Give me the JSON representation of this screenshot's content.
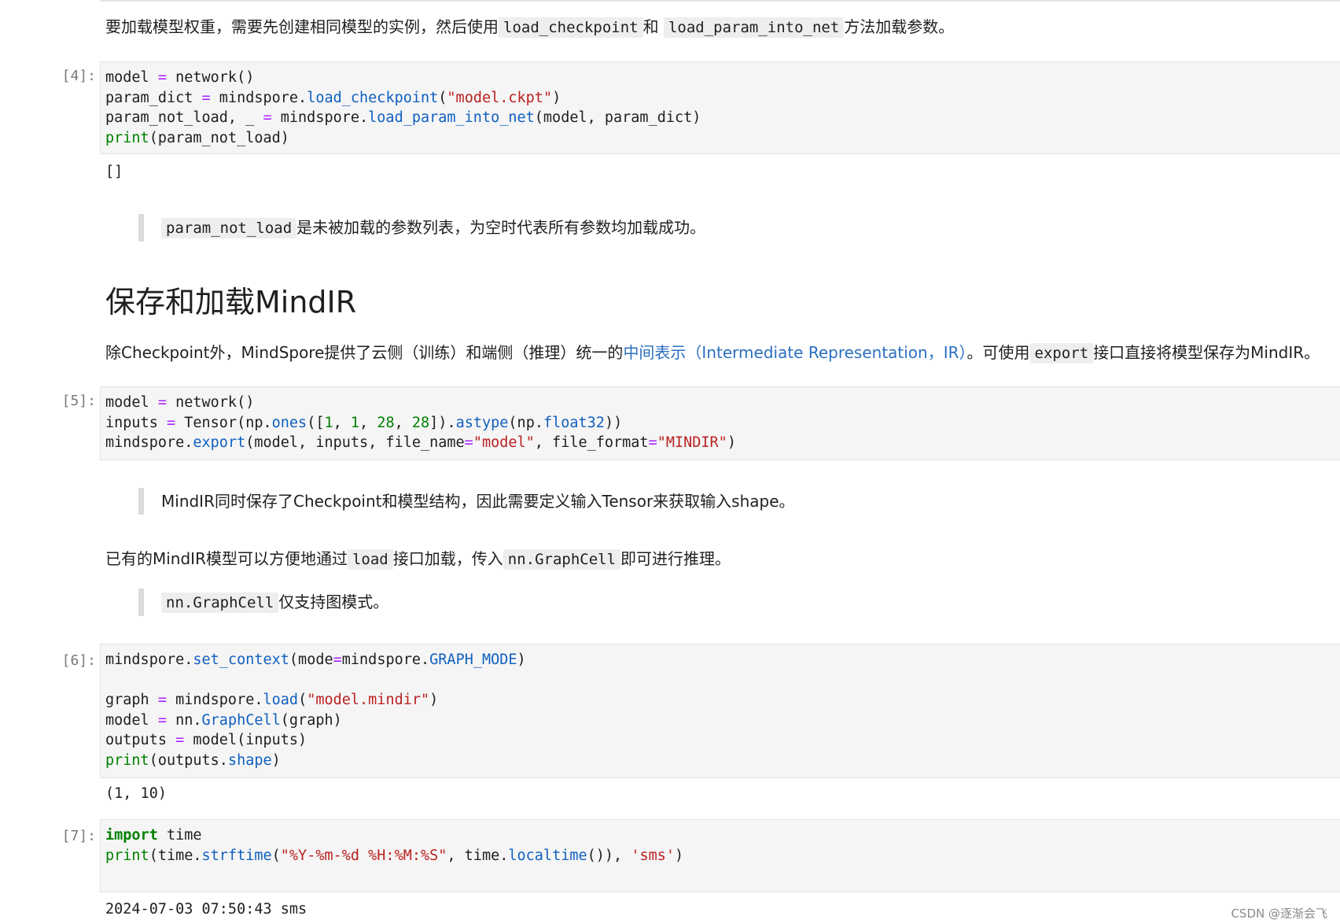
{
  "intro": {
    "p1_pre": "要加载模型权重，需要先创建相同模型的实例，然后使用",
    "p1_code1": "load_checkpoint",
    "p1_mid": "和",
    "p1_code2": "load_param_into_net",
    "p1_post": "方法加载参数。"
  },
  "cell4": {
    "prompt": "[4]:",
    "l1": {
      "a": "model ",
      "op": "=",
      "b": " network()"
    },
    "l2": {
      "a": "param_dict ",
      "op": "=",
      "b": " mindspore.",
      "fn": "load_checkpoint",
      "c": "(",
      "s": "\"model.ckpt\"",
      "d": ")"
    },
    "l3": {
      "a": "param_not_load, _ ",
      "op": "=",
      "b": " mindspore.",
      "fn": "load_param_into_net",
      "c": "(model, param_dict)"
    },
    "l4": {
      "fn": "print",
      "c": "(param_not_load)"
    },
    "output": "[]"
  },
  "note1": {
    "code": "param_not_load",
    "text": "是未被加载的参数列表，为空时代表所有参数均加载成功。"
  },
  "section": {
    "title": "保存和加载MindIR"
  },
  "p2": {
    "pre": "除Checkpoint外，MindSpore提供了云侧（训练）和端侧（推理）统一的",
    "link": "中间表示（Intermediate Representation，IR）",
    "mid": "。可使用",
    "code": "export",
    "post": "接口直接将模型保存为MindIR。"
  },
  "cell5": {
    "prompt": "[5]:",
    "l1": {
      "a": "model ",
      "op": "=",
      "b": " network()"
    },
    "l2": {
      "a": "inputs ",
      "op": "=",
      "b": " Tensor(np.",
      "fn1": "ones",
      "c": "([",
      "n1": "1",
      "s1": ", ",
      "n2": "1",
      "s2": ", ",
      "n3": "28",
      "s3": ", ",
      "n4": "28",
      "d": "]).",
      "fn2": "astype",
      "e": "(np.",
      "fn3": "float32",
      "f": "))"
    },
    "l3": {
      "a": "mindspore.",
      "fn": "export",
      "b": "(model, inputs, file_name",
      "op1": "=",
      "s1": "\"model\"",
      "c": ", file_format",
      "op2": "=",
      "s2": "\"MINDIR\"",
      "d": ")"
    }
  },
  "note2": {
    "text": "MindIR同时保存了Checkpoint和模型结构，因此需要定义输入Tensor来获取输入shape。"
  },
  "p3": {
    "pre": "已有的MindIR模型可以方便地通过",
    "code1": "load",
    "mid": "接口加载，传入",
    "code2": "nn.GraphCell",
    "post": "即可进行推理。"
  },
  "note3": {
    "code": "nn.GraphCell",
    "text": "仅支持图模式。"
  },
  "cell6": {
    "prompt": "[6]:",
    "l1": {
      "a": "mindspore.",
      "fn": "set_context",
      "b": "(mode",
      "op": "=",
      "c": "mindspore.",
      "attr": "GRAPH_MODE",
      "d": ")"
    },
    "l3": {
      "a": "graph ",
      "op": "=",
      "b": " mindspore.",
      "fn": "load",
      "c": "(",
      "s": "\"model.mindir\"",
      "d": ")"
    },
    "l4": {
      "a": "model ",
      "op": "=",
      "b": " nn.",
      "fn": "GraphCell",
      "c": "(graph)"
    },
    "l5": {
      "a": "outputs ",
      "op": "=",
      "b": " model(inputs)"
    },
    "l6": {
      "fn": "print",
      "c": "(outputs.",
      "attr": "shape",
      "d": ")"
    },
    "output": "(1, 10)"
  },
  "cell7": {
    "prompt": "[7]:",
    "l1": {
      "kw": "import",
      "a": " time"
    },
    "l2": {
      "fn": "print",
      "a": "(time.",
      "fn2": "strftime",
      "b": "(",
      "s1": "\"%Y-%m-%d %H:%M:%S\"",
      "c": ", time.",
      "fn3": "localtime",
      "d": "()), ",
      "s2": "'sms'",
      "e": ")"
    },
    "output": "2024-07-03 07:50:43 sms"
  },
  "watermark": "CSDN @逐渐会飞"
}
